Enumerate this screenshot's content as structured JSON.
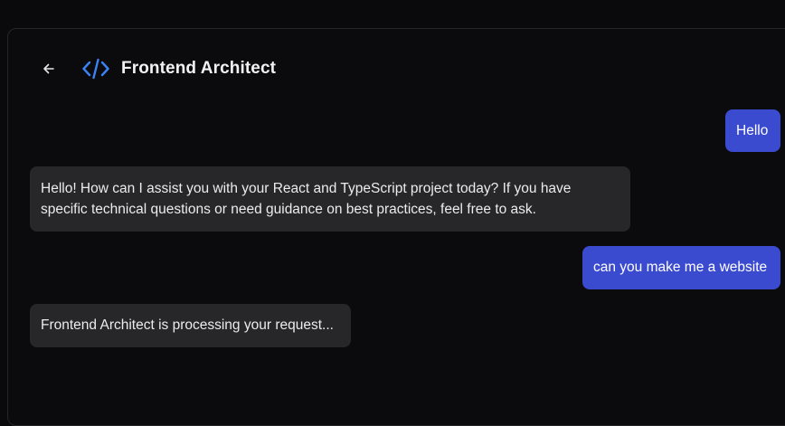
{
  "header": {
    "title": "Frontend Architect",
    "back_icon": "arrow-left-icon",
    "brand_icon": "code-icon",
    "brand_color": "#3b82f6"
  },
  "colors": {
    "user_bubble": "#3b4bd0",
    "assistant_bubble": "#27272a",
    "background": "#0b0b0d"
  },
  "messages": [
    {
      "role": "user",
      "text": "Hello"
    },
    {
      "role": "assistant",
      "lines": [
        "Hello! How can I assist you with your React and TypeScript project today? If you have",
        "specific technical questions or need guidance on best practices, feel free to ask."
      ]
    },
    {
      "role": "user",
      "text": "can you make me a website"
    },
    {
      "role": "assistant",
      "text": "Frontend Architect is processing your request..."
    }
  ]
}
